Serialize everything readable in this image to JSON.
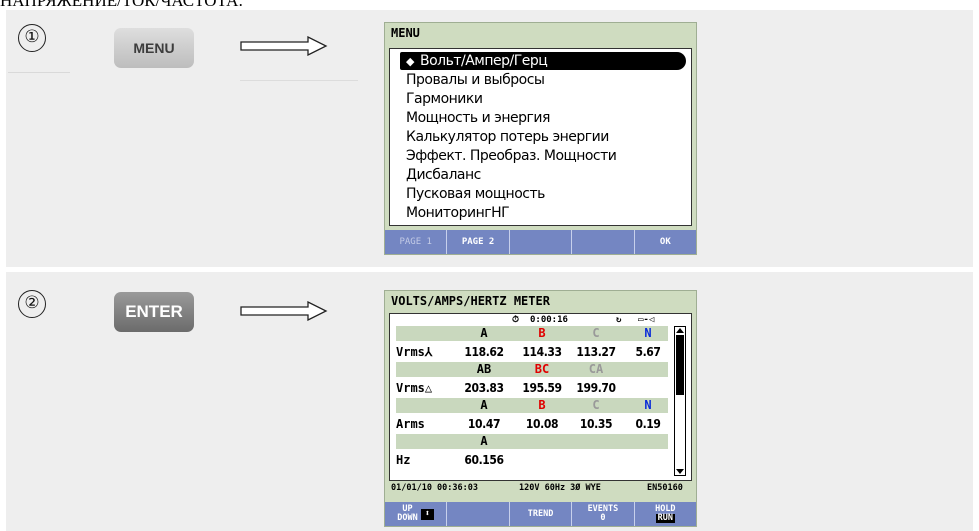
{
  "page_header": "НАПРЯЖЕНИЕ/ТОК/ЧАСТОТА:",
  "steps": [
    {
      "number": "①",
      "key": "MENU"
    },
    {
      "number": "②",
      "key": "ENTER"
    }
  ],
  "colors": {
    "row_bg": "#eeeeee",
    "screen_bg": "#cfdcc0",
    "fkey_bg": "#7486c2",
    "phase_a": "#000000",
    "phase_b": "#e00000",
    "phase_c": "#999999",
    "phase_n": "#0a2bd8"
  },
  "menu_screen": {
    "title": "MENU",
    "selected_marker": "◆",
    "items": [
      "Вольт/Ампер/Герц",
      "Провалы и выбросы",
      "Гармоники",
      "Мощность и энергия",
      "Калькулятор потерь энергии",
      "Эффект. Преобраз. Мощности",
      "Дисбаланс",
      "Пусковая мощность",
      "МониторингНГ"
    ],
    "fkeys": [
      "PAGE 1",
      "PAGE 2",
      "",
      "",
      "OK"
    ]
  },
  "meter_screen": {
    "title": "VOLTS/AMPS/HERTZ METER",
    "status": {
      "timer": "0:00:16",
      "timer_icon": "clock-icon",
      "rotation_icon": "phase-rotation-icon",
      "battery_icon": "battery-plug-icon"
    },
    "rows": {
      "phase_header": [
        "A",
        "B",
        "C",
        "N"
      ],
      "vrms_wye_label": "Vrms⅄",
      "vrms_wye": [
        "118.62",
        "114.33",
        "113.27",
        "5.67"
      ],
      "delta_header": [
        "AB",
        "BC",
        "CA"
      ],
      "vrms_delta_label": "Vrms△",
      "vrms_delta": [
        "203.83",
        "195.59",
        "199.70"
      ],
      "phase_header2": [
        "A",
        "B",
        "C",
        "N"
      ],
      "arms_label": "Arms",
      "arms": [
        "10.47",
        "10.08",
        "10.35",
        "0.19"
      ],
      "hz_header": "A",
      "hz_label": "Hz",
      "hz": "60.156"
    },
    "footer": {
      "datetime": "01/01/10 00:36:03",
      "config": "120V  60Hz 3Ø WYE",
      "standard": "EN50160"
    },
    "fkeys": {
      "f1_top": "UP",
      "f1_bottom": "DOWN",
      "f1_arrow": "⬍",
      "f2": "",
      "f3": "TREND",
      "f4_top": "EVENTS",
      "f4_bottom": "0",
      "f5_top": "HOLD",
      "f5_bottom": "RUN"
    }
  }
}
